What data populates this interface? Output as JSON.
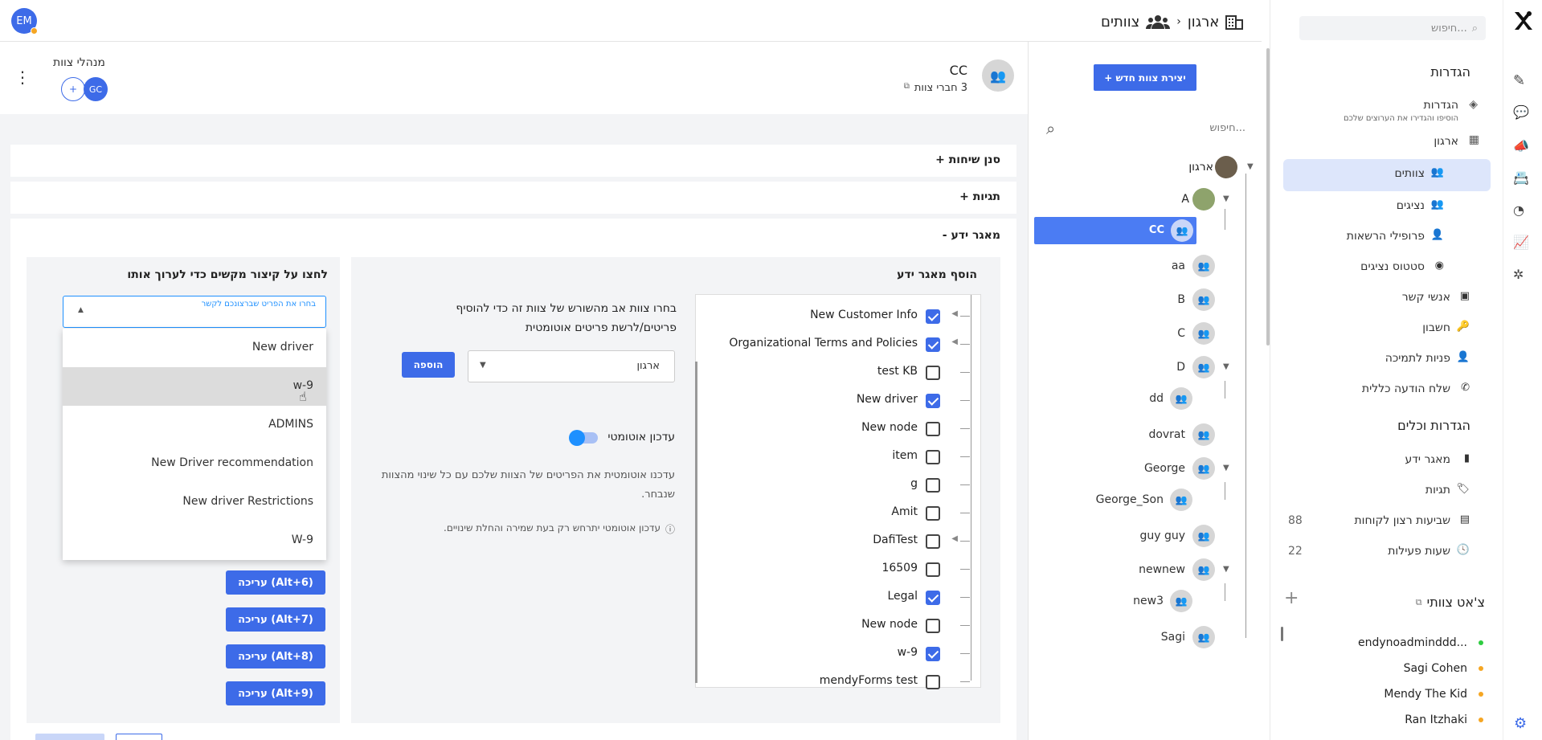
{
  "top": {
    "avatar_initials": "EM",
    "bc_org": "ארגון",
    "bc_sep": "›",
    "bc_teams": "צוותים"
  },
  "nav": {
    "search_placeholder": "חיפוש...",
    "settings_title": "הגדרות",
    "items": [
      {
        "label": "הגדרות",
        "sub": "הוסיפו והגדירו את הערוצים שלכם",
        "icon": "layers-icon"
      },
      {
        "label": "ארגון",
        "icon": "building-icon"
      },
      {
        "label": "צוותים",
        "icon": "team-icon"
      },
      {
        "label": "נציגים",
        "icon": "agents-icon"
      },
      {
        "label": "פרופילי הרשאות",
        "icon": "permissions-icon"
      },
      {
        "label": "סטטוס נציגים",
        "icon": "agent-status-icon"
      },
      {
        "label": "אנשי קשר",
        "icon": "contacts-icon"
      },
      {
        "label": "חשבון",
        "icon": "key-icon"
      },
      {
        "label": "פניות לתמיכה",
        "icon": "support-icon"
      },
      {
        "label": "שלח הודעה כללית",
        "icon": "broadcast-icon"
      }
    ],
    "tools_title": "הגדרות וכלים",
    "tools": [
      {
        "label": "מאגר ידע",
        "icon": "book-icon",
        "count": ""
      },
      {
        "label": "תגיות",
        "icon": "tag-icon",
        "count": ""
      },
      {
        "label": "שביעות רצון לקוחות",
        "icon": "survey-icon",
        "count": "88"
      },
      {
        "label": "שעות פעילות",
        "icon": "clock-icon",
        "count": "22"
      }
    ],
    "chat_title": "צ'אט צוותי",
    "chat_users": [
      {
        "name": "endynoadminddd...",
        "status": "#2ecc40"
      },
      {
        "name": "Sagi Cohen",
        "status": "#f5a623"
      },
      {
        "name": "Mendy The Kid",
        "status": "#f5a623"
      },
      {
        "name": "Ran Itzhaki",
        "status": "#f5a623"
      }
    ]
  },
  "teams": {
    "new_team_button": "+ יצירת צוות חדש",
    "search_placeholder": "חיפוש...",
    "root": "ארגון",
    "list": [
      "A",
      "CC",
      "aa",
      "B",
      "C",
      "D",
      "dd",
      "dovrat",
      "George",
      "George_Son",
      "guy guy",
      "newnew",
      "new3",
      "Sagi"
    ]
  },
  "team": {
    "name": "CC",
    "members": "3 חברי צוות",
    "managers_label": "מנהלי צוות",
    "manager_initials": "GC",
    "add_manager": "+",
    "sections": {
      "chat_filter": "+ סנן שיחות",
      "tags": "+ תגיות",
      "kb": "- מאגר ידע"
    }
  },
  "kb": {
    "add_title": "הוסף מאגר ידע",
    "items": [
      {
        "label": "New Customer Info",
        "checked": true,
        "expand": true
      },
      {
        "label": "Organizational Terms and Policies",
        "checked": true,
        "expand": true
      },
      {
        "label": "test KB",
        "checked": false,
        "expand": false
      },
      {
        "label": "New driver",
        "checked": true,
        "expand": false
      },
      {
        "label": "New node",
        "checked": false,
        "expand": false
      },
      {
        "label": "item",
        "checked": false,
        "expand": false
      },
      {
        "label": "g",
        "checked": false,
        "expand": false
      },
      {
        "label": "Amit",
        "checked": false,
        "expand": false
      },
      {
        "label": "DafiTest",
        "checked": false,
        "expand": true
      },
      {
        "label": "16509",
        "checked": false,
        "expand": false
      },
      {
        "label": "Legal",
        "checked": true,
        "expand": false
      },
      {
        "label": "New node",
        "checked": false,
        "expand": false
      },
      {
        "label": "w-9",
        "checked": true,
        "expand": false
      },
      {
        "label": "mendyForms test",
        "checked": false,
        "expand": false
      }
    ],
    "inherit_text": "בחרו צוות אב מהשורש של צוות זה כדי להוסיף פריטים/לרשת פריטים אוטומטית",
    "parent_select": "ארגון",
    "add_button": "הוספה",
    "auto_label": "עדכון אוטומטי",
    "auto_desc": "עדכנו אוטומטית את הפריטים של הצוות שלכם עם כל שינוי מהצוות שנבחר.",
    "auto_note": "עדכון אוטומטי יתרחש רק בעת שמירה והחלת שינויים.",
    "shortcut_title": "לחצו על קיצור מקשים כדי לערוך אותו",
    "dropdown_placeholder": "בחרו את הפריט שברצונכם לקשר",
    "dropdown_options": [
      "New driver",
      "w-9",
      "ADMINS",
      "New Driver recommendation",
      "New driver Restrictions",
      "W-9"
    ],
    "edit_buttons": [
      "עריכה (Alt+6)",
      "עריכה (Alt+7)",
      "עריכה (Alt+8)",
      "עריכה (Alt+9)"
    ]
  },
  "colors": {
    "accent": "#3d6be8",
    "selected": "#4b7cf3",
    "active_nav": "#dde6fb"
  }
}
